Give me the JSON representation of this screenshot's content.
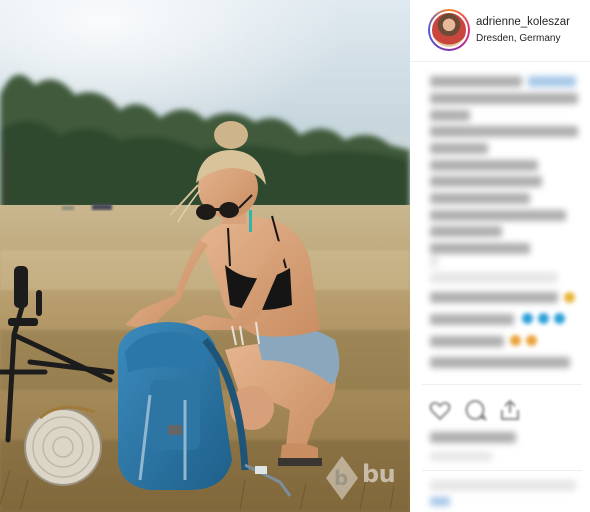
{
  "post": {
    "username": "adrienne_koleszar",
    "location": "Dresden, Germany"
  },
  "watermark": {
    "text": "bu"
  },
  "icons": [
    "heart-icon",
    "comment-icon",
    "share-icon"
  ]
}
